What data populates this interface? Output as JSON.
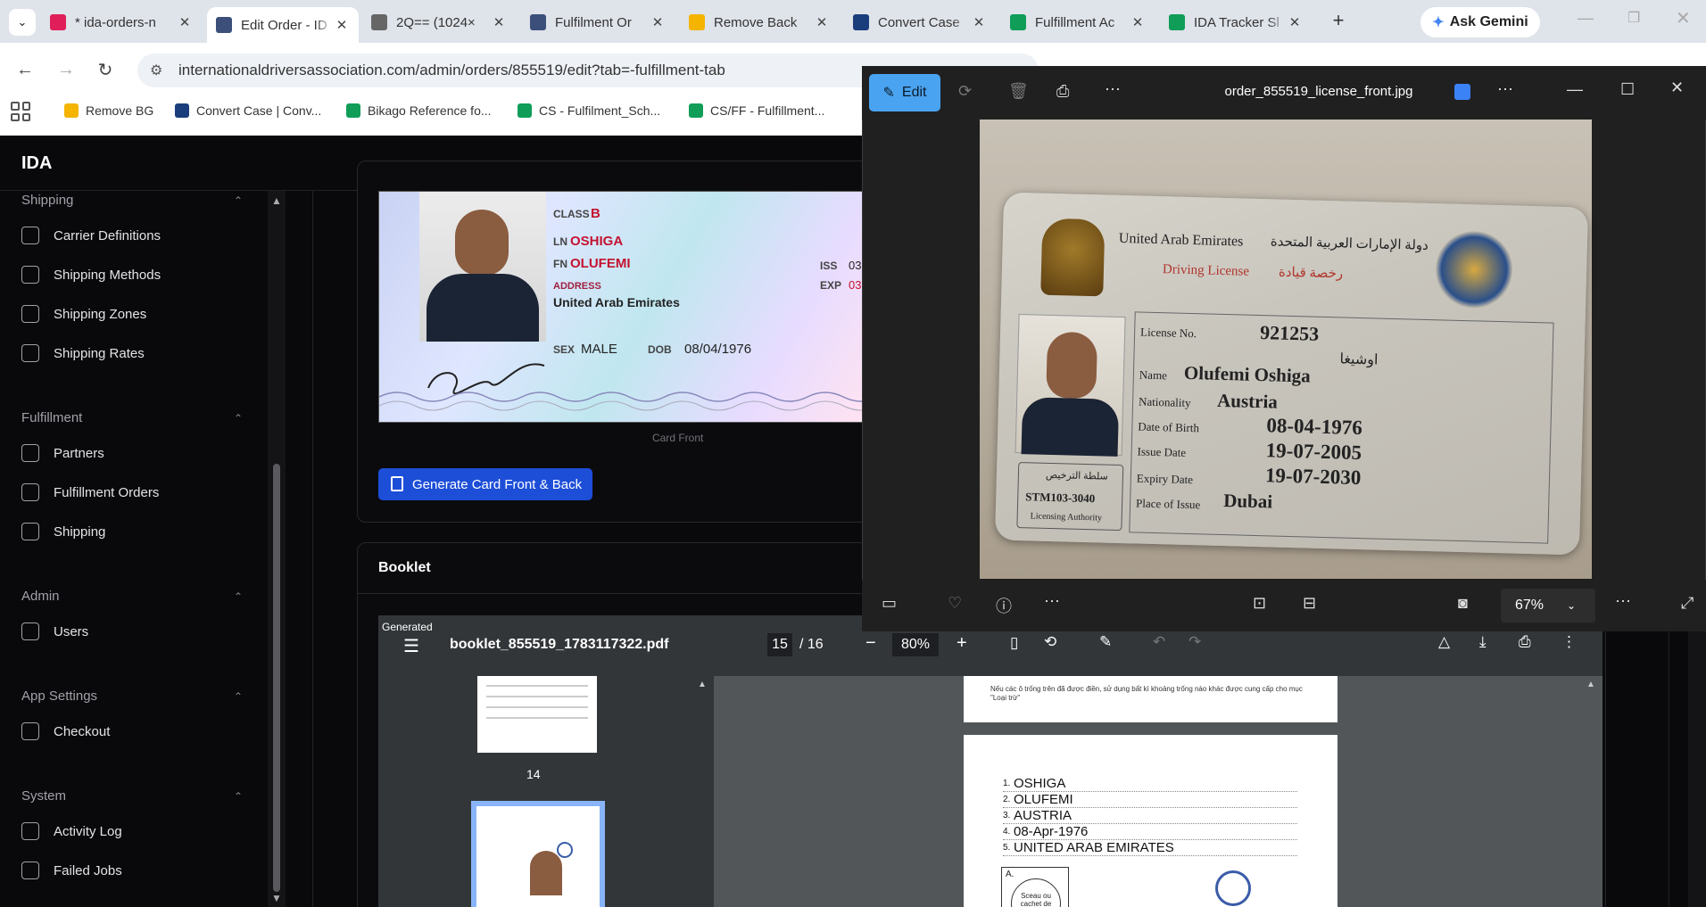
{
  "browser": {
    "tabs": [
      {
        "title": "* ida-orders-n",
        "color": "#e01e5a",
        "active": false
      },
      {
        "title": "Edit Order - ID",
        "color": "#3b4f7a",
        "active": true
      },
      {
        "title": "2Q== (1024×",
        "color": "#666",
        "active": false
      },
      {
        "title": "Fulfilment Or",
        "color": "#3b4f7a",
        "active": false
      },
      {
        "title": "Remove Back",
        "color": "#f4b400",
        "active": false
      },
      {
        "title": "Convert Case",
        "color": "#1a3d7c",
        "active": false
      },
      {
        "title": "Fulfillment Ac",
        "color": "#0f9d58",
        "active": false
      },
      {
        "title": "IDA Tracker Sl",
        "color": "#0f9d58",
        "active": false
      }
    ],
    "gemini_label": "Ask Gemini",
    "url": "internationaldriversassociation.com/admin/orders/855519/edit?tab=-fulfillment-tab",
    "bookmarks": [
      "Remove BG",
      "Convert Case | Conv...",
      "Bikago Reference fo...",
      "CS - Fulfilment_Sch...",
      "CS/FF - Fulfillment..."
    ]
  },
  "app": {
    "brand": "IDA",
    "sidebar": {
      "sections": [
        {
          "title": "Shipping",
          "items": [
            "Carrier Definitions",
            "Shipping Methods",
            "Shipping Zones",
            "Shipping Rates"
          ]
        },
        {
          "title": "Fulfillment",
          "items": [
            "Partners",
            "Fulfillment Orders",
            "Shipping"
          ]
        },
        {
          "title": "Admin",
          "items": [
            "Users"
          ]
        },
        {
          "title": "App Settings",
          "items": [
            "Checkout"
          ]
        },
        {
          "title": "System",
          "items": [
            "Activity Log",
            "Failed Jobs"
          ]
        }
      ]
    },
    "card_front": {
      "class_label": "CLASS",
      "class_value": "B",
      "ln_label": "LN",
      "ln_value": "OSHIGA",
      "fn_label": "FN",
      "fn_value": "OLUFEMI",
      "address_label": "ADDRESS",
      "address_value": "United Arab Emirates",
      "iss_label": "ISS",
      "iss_value": "03",
      "exp_label": "EXP",
      "exp_value": "03",
      "sex_label": "SEX",
      "sex_value": "MALE",
      "dob_label": "DOB",
      "dob_value": "08/04/1976",
      "caption": "Card Front"
    },
    "generate_button": "Generate Card Front & Back",
    "booklet": {
      "title": "Booklet",
      "generated_label": "Generated",
      "filename": "booklet_855519_1783117322.pdf",
      "page_current": "15",
      "page_total": "/ 16",
      "zoom": "80%",
      "thumb_page": "14",
      "page_text": "Nếu các ô trống trên đã được điền, sử dụng bất kì khoảng trống nào khác được cung cấp cho mục \"Loại trừ\"",
      "fields": [
        "OSHIGA",
        "OLUFEMI",
        "AUSTRIA",
        "08-Apr-1976",
        "UNITED ARAB EMIRATES"
      ],
      "stamp_letter": "A.",
      "stamp_text": "Sceau ou cachet de"
    }
  },
  "photos": {
    "edit_label": "Edit",
    "filename": "order_855519_license_front.jpg",
    "zoom": "67%",
    "license": {
      "country_en": "United Arab Emirates",
      "country_ar": "دولة الإمارات العربية المتحدة",
      "title_en": "Driving License",
      "title_ar": "رخصة قيادة",
      "license_no_label": "License No.",
      "license_no": "921253",
      "name_ar": "اوشيغا",
      "name_label": "Name",
      "name": "Olufemi Oshiga",
      "nationality_label": "Nationality",
      "nationality": "Austria",
      "dob_label": "Date of Birth",
      "dob": "08-04-1976",
      "issue_label": "Issue Date",
      "issue": "19-07-2005",
      "expiry_label": "Expiry Date",
      "expiry": "19-07-2030",
      "place_label": "Place of Issue",
      "place": "Dubai",
      "stamp_code": "STM103-3040",
      "stamp_caption": "Licensing Authority",
      "stamp_ar": "سلطة الترخيص"
    }
  }
}
